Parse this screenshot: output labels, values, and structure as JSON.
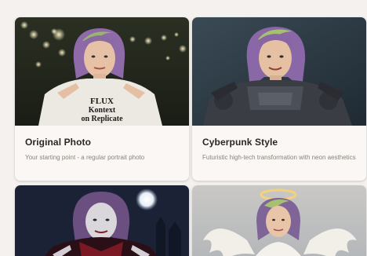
{
  "cards": [
    {
      "title": "Original Photo",
      "description": "Your starting point - a regular portrait photo",
      "image": "woman in white sweater pointing at shirt",
      "shirt_text": [
        "FLUX",
        "Kontext",
        "on Replicate"
      ]
    },
    {
      "title": "Cyberpunk Style",
      "description": "Futuristic high-tech transformation with neon aesthetics",
      "image": "woman in dark armored cyberpunk suit pointing"
    },
    {
      "title": "",
      "description": "",
      "image": "woman as vampire under full moon at night"
    },
    {
      "title": "",
      "description": "",
      "image": "woman as angel with halo and white wings"
    }
  ],
  "colors": {
    "page_bg": "#f4f1ee",
    "card_bg": "#faf7f4",
    "title_text": "#2a2623",
    "desc_text": "#8b837c"
  }
}
